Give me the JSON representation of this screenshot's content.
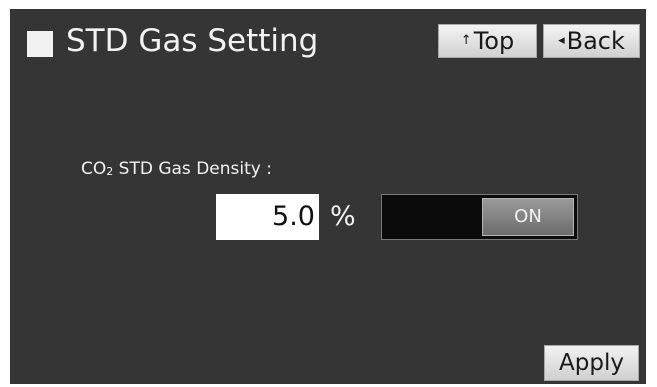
{
  "header": {
    "title": "STD Gas Setting",
    "top_button": {
      "arrow": "↑",
      "label": "Top"
    },
    "back_button": {
      "arrow": "◂",
      "label": "Back"
    }
  },
  "form": {
    "label_prefix": "CO",
    "label_subscript": "2",
    "label_suffix": " STD Gas Density :",
    "density_value": "5.0",
    "unit": "%",
    "toggle": {
      "label": "ON",
      "state": "on"
    }
  },
  "footer": {
    "apply_label": "Apply"
  },
  "colors": {
    "background": "#353535",
    "text": "#f2f2f2",
    "button_face": "#dcdcdc",
    "toggle_track": "#0b0b0b"
  }
}
